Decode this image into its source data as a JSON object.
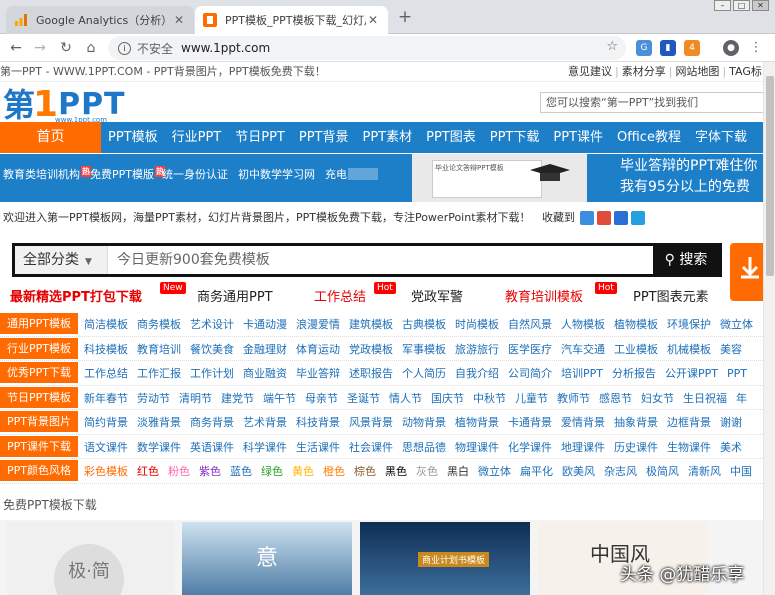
{
  "browser": {
    "tabs": [
      {
        "title": "Google Analytics（分析）",
        "active": false
      },
      {
        "title": "PPT模板_PPT模板下载_幻灯片模",
        "active": true
      }
    ],
    "url": {
      "security": "不安全",
      "host": "www.1ppt.com"
    }
  },
  "topbar": {
    "left": "第一PPT - WWW.1PPT.COM - PPT背景图片，PPT模板免费下载！",
    "links": [
      "意见建议",
      "素材分享",
      "网站地图",
      "TAG标"
    ]
  },
  "logo": {
    "part1": "第",
    "part2": "1",
    "part3": "PPT",
    "sub": "www.1ppt.com"
  },
  "search_top": {
    "placeholder": "您可以搜索“第一PPT”找到我们"
  },
  "main_nav": {
    "home": "首页",
    "items": [
      "PPT模板",
      "行业PPT",
      "节日PPT",
      "PPT背景",
      "PPT素材",
      "PPT图表",
      "PPT下载",
      "PPT课件",
      "Office教程",
      "字体下载"
    ]
  },
  "sub_nav": {
    "items": [
      "教育类培训机构",
      "免费PPT模版",
      "统一身份认证",
      "初中数学学习网",
      "充电"
    ],
    "badge": "热"
  },
  "banner": {
    "text1": "毕业答辩的PPT难住你",
    "text2": "我有95分以上的免费",
    "card": "毕业论文答辩PPT模板"
  },
  "welcome": {
    "text": "欢迎进入第一PPT模板网，海量PPT素材，幻灯片背景图片，PPT模板免费下载，专注PowerPoint素材下载！",
    "bookmark": "收藏到"
  },
  "big_search": {
    "category": "全部分类",
    "placeholder": "今日更新900套免费模板",
    "button": "搜索"
  },
  "hot_links": [
    {
      "text": "最新精选PPT打包下载",
      "hot": true,
      "badge": "New"
    },
    {
      "text": "商务通用PPT",
      "hot": false
    },
    {
      "text": "工作总结",
      "hot": true,
      "badge": "Hot"
    },
    {
      "text": "党政军警",
      "hot": false
    },
    {
      "text": "教育培训模板",
      "hot": true,
      "badge": "Hot"
    },
    {
      "text": "PPT图表元素",
      "hot": false
    }
  ],
  "categories": [
    {
      "label": "通用PPT模板",
      "tags": [
        "简洁模板",
        "商务模板",
        "艺术设计",
        "卡通动漫",
        "浪漫爱情",
        "建筑模板",
        "古典模板",
        "时尚模板",
        "自然风景",
        "人物模板",
        "植物模板",
        "环境保护",
        "微立体"
      ]
    },
    {
      "label": "行业PPT模板",
      "tags": [
        "科技模板",
        "教育培训",
        "餐饮美食",
        "金融理财",
        "体育运动",
        "党政模板",
        "军事模板",
        "旅游旅行",
        "医学医疗",
        "汽车交通",
        "工业模板",
        "机械模板",
        "美容"
      ]
    },
    {
      "label": "优秀PPT下载",
      "tags": [
        "工作总结",
        "工作汇报",
        "工作计划",
        "商业融资",
        "毕业答辩",
        "述职报告",
        "个人简历",
        "自我介绍",
        "公司简介",
        "培训PPT",
        "分析报告",
        "公开课PPT",
        "PPT"
      ]
    },
    {
      "label": "节日PPT模板",
      "tags": [
        "新年春节",
        "劳动节",
        "清明节",
        "建党节",
        "端午节",
        "母亲节",
        "圣诞节",
        "情人节",
        "国庆节",
        "中秋节",
        "儿童节",
        "教师节",
        "感恩节",
        "妇女节",
        "生日祝福",
        "年"
      ]
    },
    {
      "label": "PPT背景图片",
      "tags": [
        "简约背景",
        "淡雅背景",
        "商务背景",
        "艺术背景",
        "科技背景",
        "风景背景",
        "动物背景",
        "植物背景",
        "卡通背景",
        "爱情背景",
        "抽象背景",
        "边框背景",
        "谢谢"
      ]
    },
    {
      "label": "PPT课件下载",
      "tags": [
        "语文课件",
        "数学课件",
        "英语课件",
        "科学课件",
        "生活课件",
        "社会课件",
        "思想品德",
        "物理课件",
        "化学课件",
        "地理课件",
        "历史课件",
        "生物课件",
        "美术"
      ]
    },
    {
      "label": "PPT颜色风格",
      "tags": [
        "彩色模板",
        "红色",
        "粉色",
        "紫色",
        "蓝色",
        "绿色",
        "黄色",
        "橙色",
        "棕色",
        "黑色",
        "灰色",
        "黑白",
        "微立体",
        "扁平化",
        "欧美风",
        "杂志风",
        "极简风",
        "清新风",
        "中国"
      ]
    }
  ],
  "color_tags": [
    "#ff6b00",
    "#e60000",
    "#ff66b2",
    "#8b2fc9",
    "#1e6fb8",
    "#2ba02b",
    "#ffb400",
    "#ff7f00",
    "#8b5a2b",
    "#000000",
    "#999999",
    "#333333"
  ],
  "free_section": {
    "title": "免费PPT模板下载"
  },
  "thumbnails": [
    {
      "text": "极·简"
    },
    {
      "text": "意"
    },
    {
      "text": "商业计划书模板"
    },
    {
      "text": "中国风"
    }
  ],
  "watermark": "头条 @犹醋乐享"
}
